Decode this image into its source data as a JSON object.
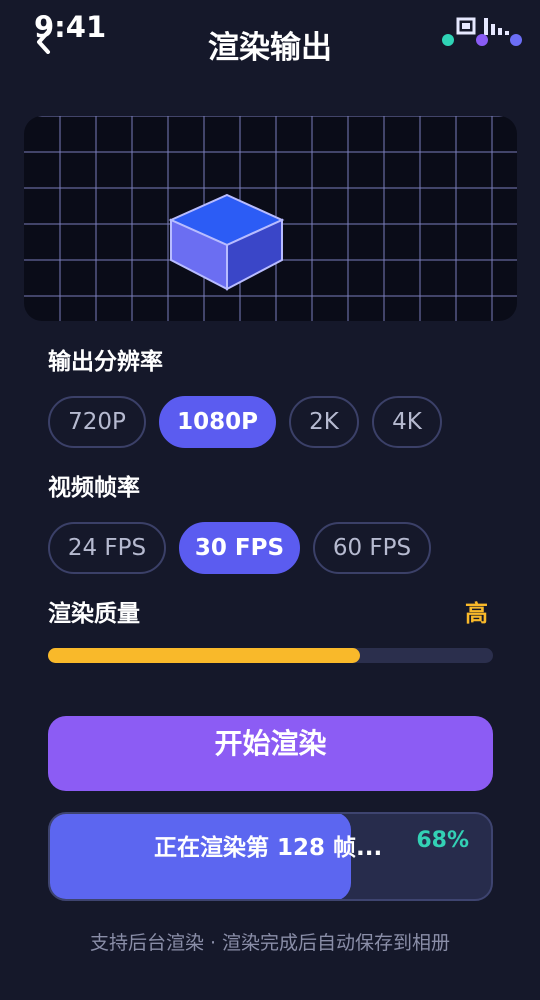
{
  "status_bar": {
    "time": "9:41",
    "icons": [
      "screen-record-icon",
      "signal-bars-icon"
    ],
    "dot_colors": [
      "#2fd3b6",
      "#8a5cf5",
      "#6c6ef5"
    ]
  },
  "header": {
    "back_icon": "chevron-left-icon",
    "title": "渲染输出"
  },
  "preview": {
    "background": "#0a0c18",
    "grid_color": "#8f92d8",
    "cube_top_color": "#2c5cf5",
    "cube_left_color": "#6b6ef2",
    "cube_right_color": "#3a46c8"
  },
  "resolution": {
    "label": "输出分辨率",
    "options": [
      "720P",
      "1080P",
      "2K",
      "4K"
    ],
    "selected": "1080P"
  },
  "frame_rate": {
    "label": "视频帧率",
    "options": [
      "24 FPS",
      "30 FPS",
      "60 FPS"
    ],
    "selected": "30 FPS"
  },
  "quality": {
    "label": "渲染质量",
    "value": "高",
    "level": 0.7,
    "accent": "#f9b92a"
  },
  "actions": {
    "start_label": "开始渲染"
  },
  "progress": {
    "text": "正在渲染第 128 帧...",
    "percent_label": "68%",
    "fraction": 0.68
  },
  "footer": {
    "note": "支持后台渲染 · 渲染完成后自动保存到相册"
  }
}
